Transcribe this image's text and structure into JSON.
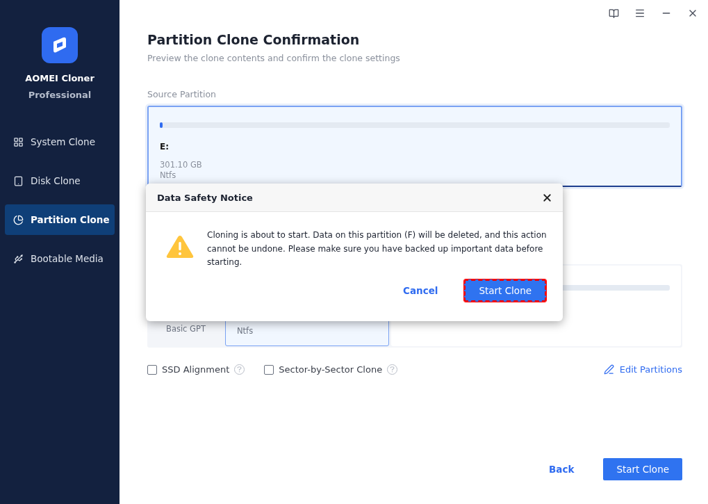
{
  "app": {
    "name": "AOMEI Cloner",
    "edition": "Professional"
  },
  "sidebar": {
    "items": [
      {
        "label": "System Clone",
        "selected": false
      },
      {
        "label": "Disk Clone",
        "selected": false
      },
      {
        "label": "Partition Clone",
        "selected": true
      },
      {
        "label": "Bootable Media",
        "selected": false
      }
    ]
  },
  "page": {
    "title": "Partition Clone Confirmation",
    "subtitle": "Preview the clone contents and confirm the clone settings"
  },
  "source": {
    "label": "Source Partition",
    "partition": {
      "letter": "E:",
      "size": "301.10 GB",
      "filesystem": "Ntfs",
      "level": 0.005,
      "selected": true
    }
  },
  "destination": {
    "disk": {
      "type": "Basic GPT"
    },
    "partitions": [
      {
        "filesystem": "Ntfs",
        "selected": true
      },
      {
        "selected": false
      }
    ]
  },
  "options": [
    {
      "label": "SSD Alignment",
      "checked": false
    },
    {
      "label": "Sector-by-Sector Clone",
      "checked": false
    }
  ],
  "edit_partitions": "Edit Partitions",
  "footer": {
    "back": "Back",
    "start": "Start Clone"
  },
  "dialog": {
    "title": "Data Safety Notice",
    "message": "Cloning is about to start. Data on this partition (F) will be deleted, and this action cannot be undone. Please make sure you have backed up important data before starting.",
    "cancel": "Cancel",
    "confirm": "Start Clone",
    "confirm_highlighted": true
  }
}
